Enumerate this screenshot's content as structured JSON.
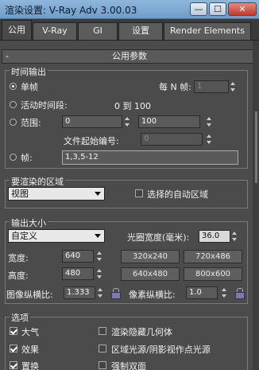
{
  "window": {
    "title": "渲染设置: V-Ray Adv 3.00.03",
    "min_label": "—",
    "max_label": "☐",
    "close_label": "✕"
  },
  "tabs": [
    {
      "label": "公用",
      "active": true
    },
    {
      "label": "V-Ray",
      "active": false
    },
    {
      "label": "GI",
      "active": false
    },
    {
      "label": "设置",
      "active": false
    },
    {
      "label": "Render Elements",
      "active": false
    }
  ],
  "rollout": {
    "title": "公用参数",
    "toggle": "-"
  },
  "time_output": {
    "title": "时间输出",
    "single_label": "单帧",
    "every_n_label": "每 N 帧:",
    "every_n_value": "1",
    "active_label": "活动时间段:",
    "active_range": "0 到 100",
    "range_label": "范围:",
    "range_from": "0",
    "range_to_label": "至",
    "range_to": "100",
    "file_start_label": "文件起始编号:",
    "file_start_value": "0",
    "frames_label": "帧:",
    "frames_value": "1,3,5-12",
    "selected": "single"
  },
  "area": {
    "title": "要渲染的区域",
    "dropdown_value": "视图",
    "auto_region_label": "选择的自动区域",
    "auto_region_checked": false
  },
  "output_size": {
    "title": "输出大小",
    "preset_value": "自定义",
    "aperture_label": "光圈宽度(毫米):",
    "aperture_value": "36.0",
    "width_label": "宽度:",
    "width_value": "640",
    "height_label": "高度:",
    "height_value": "480",
    "presets": [
      "320x240",
      "720x486",
      "640x480",
      "800x600"
    ],
    "image_aspect_label": "图像纵横比:",
    "image_aspect_value": "1.333",
    "pixel_aspect_label": "像素纵横比:",
    "pixel_aspect_value": "1.0"
  },
  "options": {
    "title": "选项",
    "items": [
      {
        "label": "大气",
        "checked": true
      },
      {
        "label": "渲染隐藏几何体",
        "checked": false
      },
      {
        "label": "效果",
        "checked": true
      },
      {
        "label": "区域光源/阴影视作点光源",
        "checked": false
      },
      {
        "label": "置换",
        "checked": true
      },
      {
        "label": "强制双面",
        "checked": false
      }
    ]
  }
}
